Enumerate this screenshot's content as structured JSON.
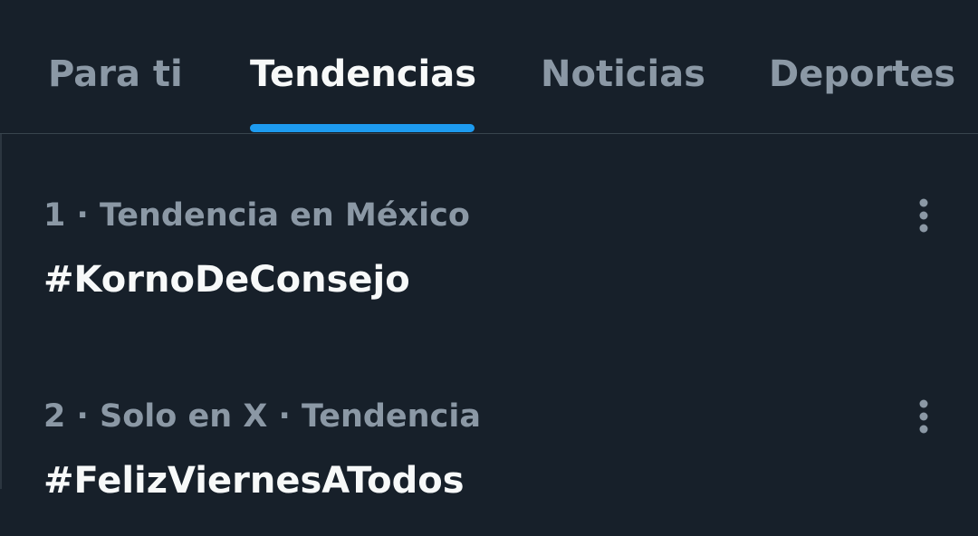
{
  "tabs": [
    {
      "label": "Para ti",
      "active": false
    },
    {
      "label": "Tendencias",
      "active": true
    },
    {
      "label": "Noticias",
      "active": false
    },
    {
      "label": "Deportes",
      "active": false
    }
  ],
  "trends": [
    {
      "meta": "1 · Tendencia en México",
      "title": "#KornoDeConsejo"
    },
    {
      "meta": "2 · Solo en X · Tendencia",
      "title": "#FelizViernesATodos"
    }
  ],
  "colors": {
    "background": "#17202a",
    "accent": "#1d9bf0",
    "text_primary": "#f7f9f9",
    "text_secondary": "#8b98a5"
  },
  "icons": {
    "more": "more-vertical-icon"
  }
}
